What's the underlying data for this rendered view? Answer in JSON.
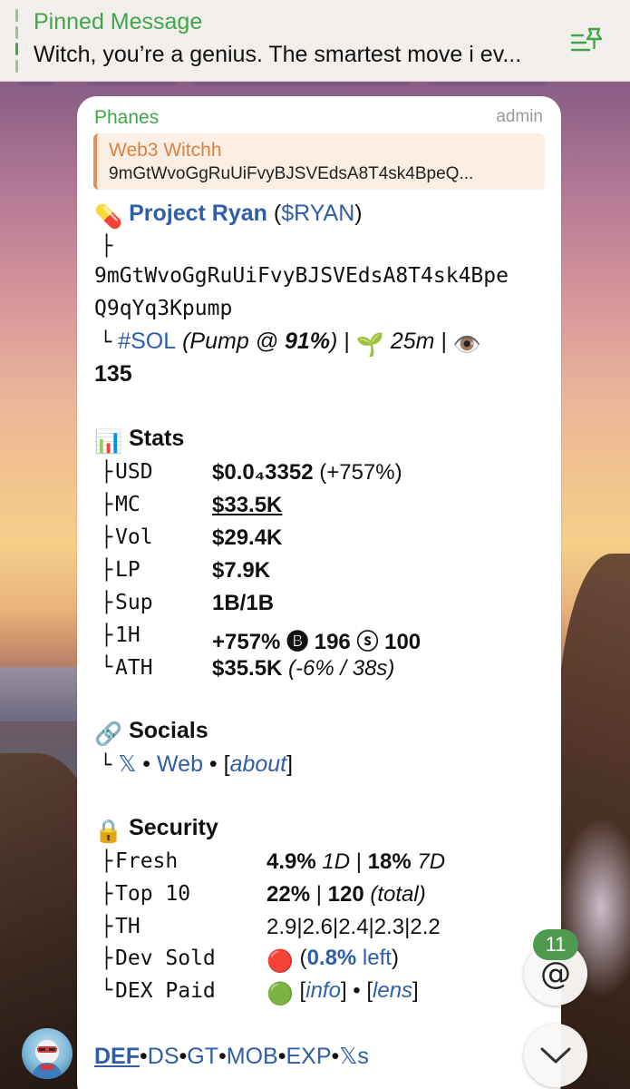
{
  "pinned": {
    "title": "Pinned Message",
    "text": "Witch, you’re a genius. The smartest move i ev..."
  },
  "message": {
    "sender": "Phanes",
    "role": "admin",
    "reply": {
      "name": "Web3 Witchh",
      "text": "9mGtWvoGgRuUiFvyBJSVEdsA8T4sk4BpeQ..."
    },
    "token": {
      "emoji": "💊",
      "name": "Project Ryan",
      "ticker_open": " (",
      "ticker": "$RYAN",
      "ticker_close": ")",
      "tree_branch": "├",
      "address_line1": "9mGtWvoGgRuUiFvyBJSVEdsA8T4sk4Bpe",
      "address_line2": "Q9qYq3Kpump",
      "tree_end": "└",
      "chain": "#SOL",
      "pump_prefix": " (Pump @ ",
      "pump_pct": "91%",
      "pump_suffix": ")",
      "sep": " | ",
      "age_emoji": "🌱",
      "age": " 25m",
      "sep2": " | ",
      "views_emoji": "👁️",
      "views": "135"
    },
    "stats": {
      "emoji": "📊",
      "title": "Stats",
      "rows": [
        {
          "branch": "├",
          "label": "USD",
          "value_bold": "$0.0₄3352",
          "value_rest": " (+757%)"
        },
        {
          "branch": "├",
          "label": "MC",
          "value_bold": "$33.5K",
          "value_rest": ""
        },
        {
          "branch": "├",
          "label": "Vol",
          "value_bold": "$29.4K",
          "value_rest": ""
        },
        {
          "branch": "├",
          "label": "LP",
          "value_bold": "$7.9K",
          "value_rest": ""
        },
        {
          "branch": "├",
          "label": "Sup",
          "value_bold": "1B/1B",
          "value_rest": ""
        },
        {
          "branch": "├",
          "label": "1H",
          "value_bold": "+757% 🅑 196 ⓢ 100",
          "value_rest": ""
        },
        {
          "branch": "└",
          "label": "ATH",
          "value_bold": "$35.5K",
          "value_rest": " (-6% / 38s)"
        }
      ]
    },
    "socials": {
      "emoji": "🔗",
      "title": "Socials",
      "branch": "└",
      "x": "𝕏",
      "dot1": " • ",
      "web": "Web",
      "dot2": " • [",
      "about": "about",
      "close": "]"
    },
    "security": {
      "emoji": "🔒",
      "title": "Security",
      "rows": [
        {
          "branch": "├",
          "label": "Fresh"
        },
        {
          "branch": "├",
          "label": "Top 10"
        },
        {
          "branch": "├",
          "label": "TH"
        },
        {
          "branch": "├",
          "label": "Dev Sold"
        },
        {
          "branch": "└",
          "label": "DEX Paid"
        }
      ],
      "fresh": {
        "a": "4.9%",
        "a_unit": " 1D",
        "sep": " | ",
        "b": "18%",
        "b_unit": " 7D"
      },
      "top10": {
        "a": "22%",
        "sep": " | ",
        "b": "120",
        "b_unit": " (total)"
      },
      "th": "2.9|2.6|2.4|2.3|2.2",
      "dev_sold": {
        "icon": "🔴",
        "open": " (",
        "pct": "0.8%",
        "left": " left",
        "close": ")"
      },
      "dex_paid": {
        "icon": "🟢",
        "open": " [",
        "info": "info",
        "mid": "] • [",
        "lens": "lens",
        "close": "]"
      }
    },
    "footer_links": {
      "def": "DEF",
      "d1": "•",
      "ds": "DS",
      "d2": "•",
      "gt": "GT",
      "d3": "•",
      "mob": "MOB",
      "d4": "•",
      "exp": "EXP",
      "d5": "•",
      "xs": "𝕏s"
    }
  },
  "mention_count": "11",
  "mention_symbol": "@",
  "colors": {
    "green": "#3fa74a",
    "link": "#2f5ea8",
    "reply_accent": "#e0935a",
    "badge": "#4e9a4f"
  }
}
